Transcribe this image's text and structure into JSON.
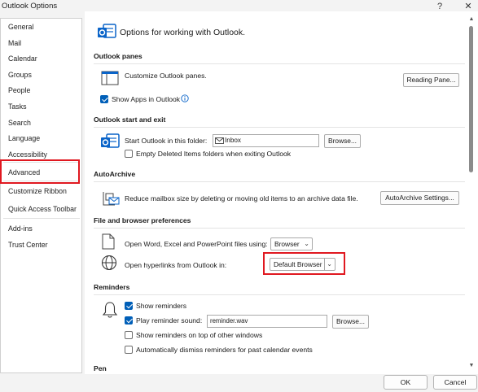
{
  "window": {
    "title": "Outlook Options",
    "help": "?",
    "close": "✕"
  },
  "sidebar": {
    "items": [
      {
        "label": "General"
      },
      {
        "label": "Mail"
      },
      {
        "label": "Calendar"
      },
      {
        "label": "Groups"
      },
      {
        "label": "People"
      },
      {
        "label": "Tasks"
      },
      {
        "label": "Search"
      },
      {
        "label": "Language"
      },
      {
        "label": "Accessibility"
      },
      {
        "label": "Advanced",
        "selected": true
      },
      {
        "label": "Customize Ribbon"
      },
      {
        "label": "Quick Access Toolbar"
      },
      {
        "label": "Add-ins"
      },
      {
        "label": "Trust Center"
      }
    ]
  },
  "header": {
    "title": "Options for working with Outlook."
  },
  "panes": {
    "title": "Outlook panes",
    "customize_text": "Customize Outlook panes.",
    "reading_pane_button": "Reading Pane...",
    "show_apps_label": "Show Apps in Outlook",
    "show_apps_checked": true
  },
  "startup": {
    "title": "Outlook start and exit",
    "start_folder_label": "Start Outlook in this folder:",
    "start_folder_value": "Inbox",
    "browse_button": "Browse...",
    "empty_deleted_label": "Empty Deleted Items folders when exiting Outlook",
    "empty_deleted_checked": false
  },
  "autoarchive": {
    "title": "AutoArchive",
    "description": "Reduce mailbox size by deleting or moving old items to an archive data file.",
    "settings_button": "AutoArchive Settings..."
  },
  "browser": {
    "title": "File and browser preferences",
    "open_files_label": "Open Word, Excel and PowerPoint files using:",
    "open_files_value": "Browser",
    "hyperlinks_label": "Open hyperlinks from Outlook in:",
    "hyperlinks_value": "Default Browser"
  },
  "reminders": {
    "title": "Reminders",
    "show_reminders_label": "Show reminders",
    "show_reminders_checked": true,
    "play_sound_label": "Play reminder sound:",
    "play_sound_checked": true,
    "sound_file": "reminder.wav",
    "browse_button": "Browse...",
    "on_top_label": "Show reminders on top of other windows",
    "on_top_checked": false,
    "auto_dismiss_label": "Automatically dismiss reminders for past calendar events",
    "auto_dismiss_checked": false
  },
  "pen": {
    "title": "Pen"
  },
  "footer": {
    "ok": "OK",
    "cancel": "Cancel"
  },
  "colors": {
    "highlight": "#e01820",
    "accent": "#005fb8"
  }
}
